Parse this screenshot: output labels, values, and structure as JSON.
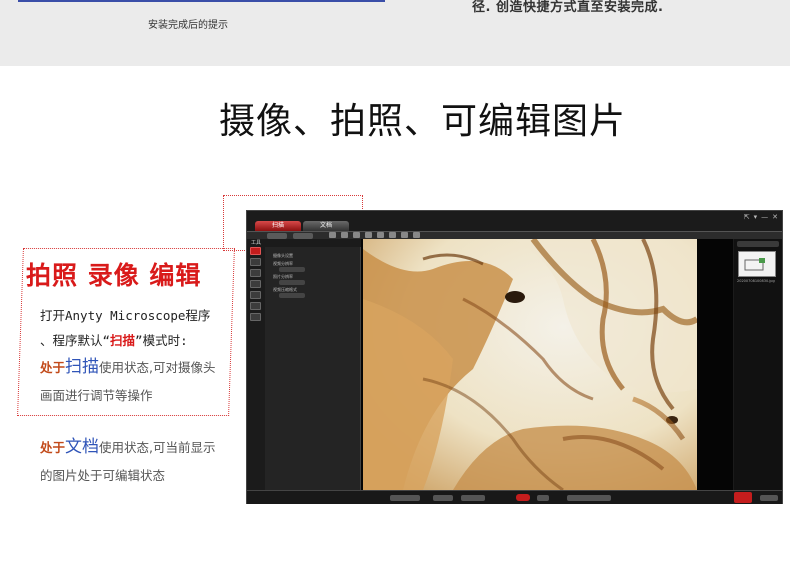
{
  "top_band": {
    "caption_left": "安装完成后的提示",
    "caption_right": "径. 创造快捷方式直至安装完成."
  },
  "heading": "摄像、拍照、可编辑图片",
  "callout": {
    "title": "拍照 录像 编辑",
    "line1": "打开Anyty Microscope程序",
    "line2_prefix": "、程序默认“",
    "line2_red": "扫描",
    "line2_suffix": "”模式时:",
    "scan_lead": "处于",
    "scan_big": "扫描",
    "scan_text": "使用状态,可对摄像头",
    "scan_text2": "画面进行调节等操作",
    "doc_lead": "处于",
    "doc_big": "文档",
    "doc_text": "使用状态,可当前显示",
    "doc_text2": "的图片处于可编辑状态"
  },
  "app": {
    "tab_scan": "扫描",
    "tab_document": "文档",
    "side_label": "工具",
    "window_controls": [
      "⇱",
      "▾",
      "—",
      "✕"
    ],
    "params": [
      "摄像头设置",
      "视频分辨率",
      "照片分辨率",
      "视频压缩格式"
    ],
    "thumb_caption": "20200708100830.jpg"
  },
  "colors": {
    "accent_red": "#d91a1a",
    "accent_blue": "#2f54b8",
    "lead_orange": "#c24a1a"
  }
}
